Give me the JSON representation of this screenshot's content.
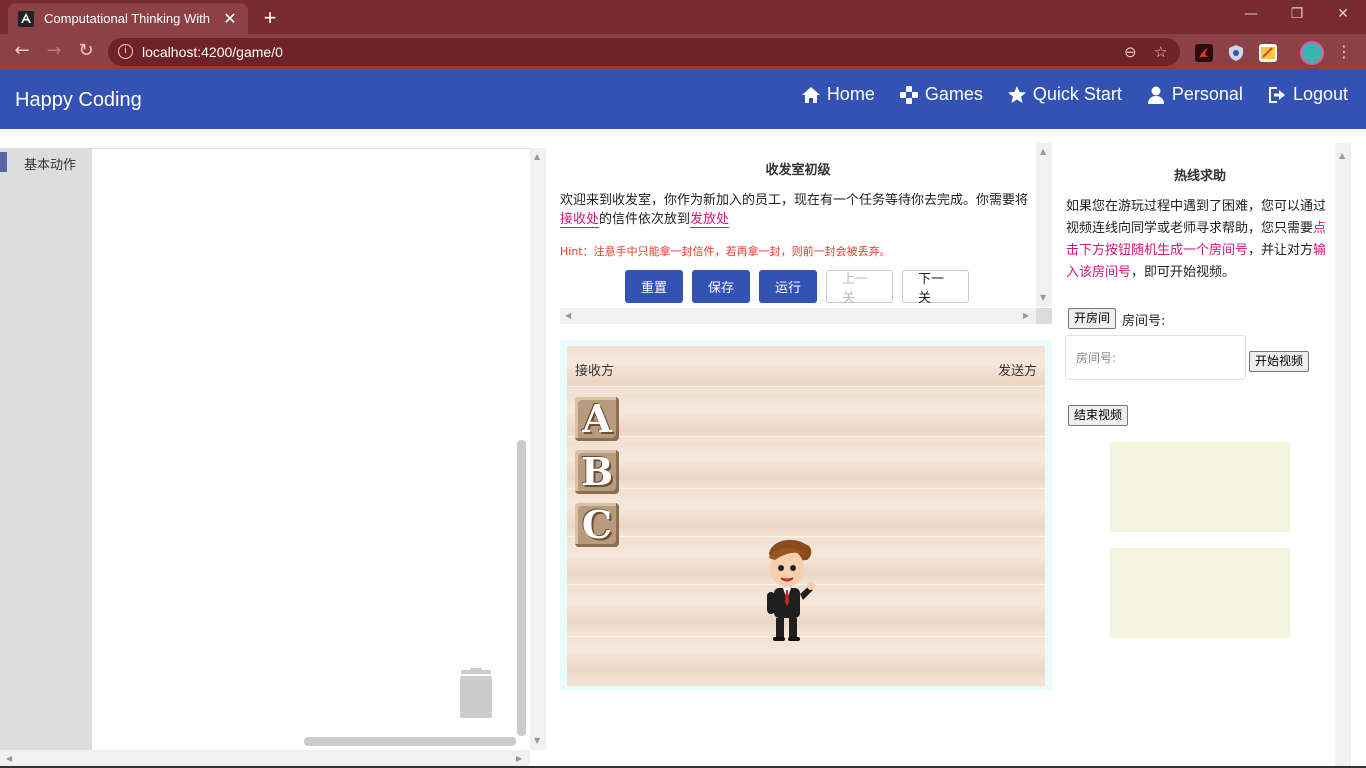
{
  "browser": {
    "tab_title": "Computational Thinking With",
    "url": "localhost:4200/game/0",
    "new_tab": "+",
    "tab_close": "✕"
  },
  "app": {
    "brand": "Happy Coding",
    "nav": [
      {
        "label": "Home",
        "icon": "home-icon"
      },
      {
        "label": "Games",
        "icon": "gamepad-icon"
      },
      {
        "label": "Quick Start",
        "icon": "star-icon"
      },
      {
        "label": "Personal",
        "icon": "person-icon"
      },
      {
        "label": "Logout",
        "icon": "logout-icon"
      }
    ]
  },
  "toolbox": {
    "category": "基本动作",
    "category_color": "#5b67a5"
  },
  "task": {
    "title": "收发室初级",
    "desc_part1": "欢迎来到收发室，你作为新加入的员工，现在有一个任务等待你去完成。你需要将",
    "desc_highlight1": "接收处",
    "desc_part2": "的信件依次放到",
    "desc_highlight2": "发放处",
    "hint": "Hint：注意手中只能拿一封信件，若再拿一封，则前一封会被丢弃。",
    "buttons": {
      "reset": "重置",
      "save": "保存",
      "run": "运行",
      "prev": "上一关",
      "next": "下一关"
    }
  },
  "stage": {
    "receiver_label": "接收方",
    "sender_label": "发送方",
    "letters": [
      "A",
      "B",
      "C"
    ]
  },
  "help": {
    "title": "热线求助",
    "desc_part1": "如果您在游玩过程中遇到了困难，您可以通过视频连线向同学或老师寻求帮助，您只需要",
    "desc_highlight1": "点击下方按钮随机生成一个房间号",
    "desc_part2": "，并让对方",
    "desc_highlight2": "输入该房间号",
    "desc_part3": "，即可开始视频。",
    "open_room": "开房间",
    "room_label": "房间号:",
    "room_placeholder": "房间号:",
    "start_video": "开始视频",
    "end_video": "结束视频"
  },
  "colors": {
    "brand_blue": "#3452b4",
    "highlight": "#d6157b",
    "hint": "#e23b2a",
    "browser_frame": "#772a2f"
  }
}
